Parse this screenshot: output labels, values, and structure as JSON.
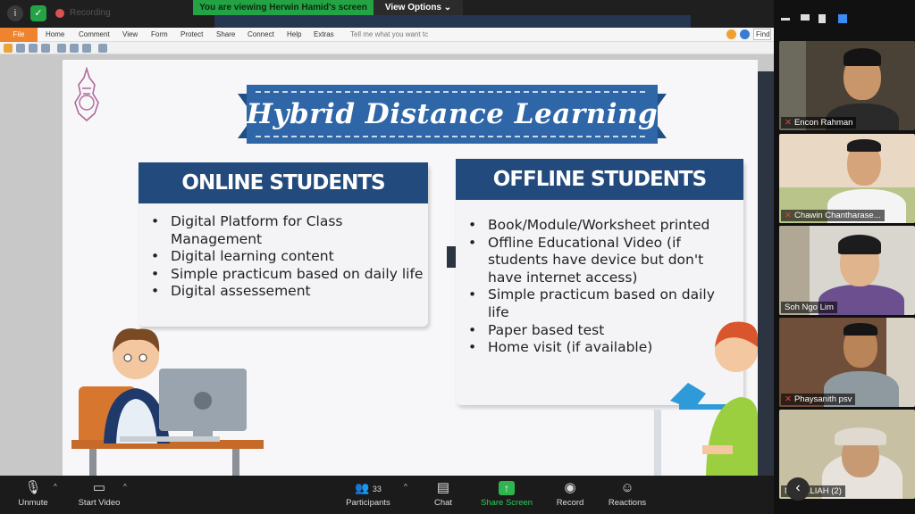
{
  "topbar": {
    "info_icon": "info-icon",
    "shield_icon": "shield-icon",
    "recording_label": "Recording",
    "banner": "You are viewing Herwin Hamid's screen",
    "view_options": "View Options ⌄"
  },
  "ribbon": {
    "file": "File",
    "tabs": [
      "Home",
      "Comment",
      "View",
      "Form",
      "Protect",
      "Share",
      "Connect",
      "Help",
      "Extras"
    ],
    "tell_me": "Tell me what you want tc",
    "find": "Find"
  },
  "slide": {
    "title": "Hybrid Distance Learning",
    "online": {
      "heading": "ONLINE STUDENTS",
      "items": [
        "Digital Platform for Class Management",
        "Digital learning content",
        "Simple practicum based on daily life",
        "Digital assessement"
      ]
    },
    "offline": {
      "heading": "OFFLINE STUDENTS",
      "items": [
        "Book/Module/Worksheet printed",
        "Offline Educational Video (if students have device but don't have internet access)",
        "Simple practicum based on daily life",
        "Paper based test",
        "Home visit (if available)"
      ]
    },
    "colors": {
      "navy": "#234a7c",
      "ribbon": "#2e66a8",
      "slide_bg": "#f7f7f9"
    }
  },
  "footer": {
    "unmute": "Unmute",
    "start_video": "Start Video",
    "participants": "Participants",
    "participants_count": "33",
    "chat": "Chat",
    "share_screen": "Share Screen",
    "record": "Record",
    "reactions": "Reactions"
  },
  "gallery": {
    "participants": [
      {
        "name": "Encon Rahman",
        "muted": true
      },
      {
        "name": "Chawin Chantharase...",
        "muted": true
      },
      {
        "name": "Soh Ngo Lim",
        "muted": false
      },
      {
        "name": "Phaysanith psv",
        "muted": true
      },
      {
        "name": "NOORLIAH (2)",
        "muted": false
      }
    ]
  }
}
